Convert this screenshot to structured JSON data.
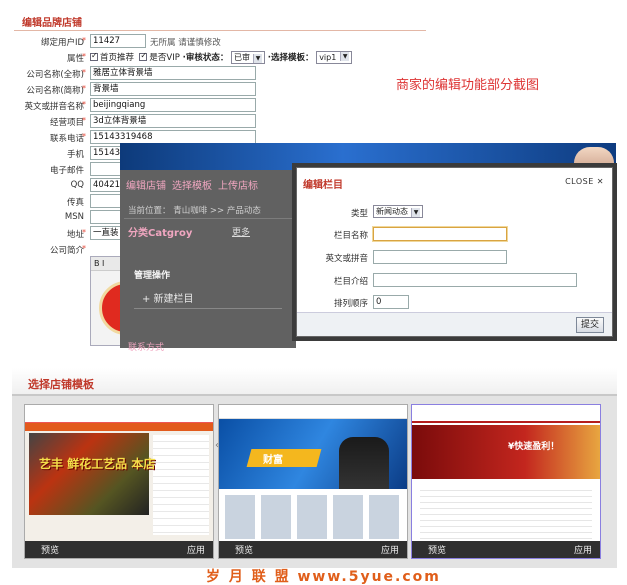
{
  "form": {
    "title": "编辑品牌店铺",
    "fields": [
      {
        "label": "绑定用户ID",
        "value": "11427",
        "note": "无所属  请谨慎修改"
      },
      {
        "label": "属性",
        "check1": "首页推荐",
        "check2": "是否VIP",
        "audit_label": "审核状态：",
        "audit_value": "已审",
        "tpl_label": "选择模板：",
        "tpl_value": "vip1"
      },
      {
        "label": "公司名称(全称)",
        "value": "雅居立体背景墙"
      },
      {
        "label": "公司名称(简称)",
        "value": "背景墙"
      },
      {
        "label": "英文或拼音名称",
        "value": "beijingqiang"
      },
      {
        "label": "经营项目",
        "value": "3d立体背景墙"
      },
      {
        "label": "联系电话",
        "value": "15143319468"
      },
      {
        "label": "手机",
        "value": "1514331"
      },
      {
        "label": "电子邮件",
        "value": ""
      },
      {
        "label": "QQ",
        "value": "40421345"
      },
      {
        "label": "传真",
        "value": ""
      },
      {
        "label": "MSN",
        "value": ""
      },
      {
        "label": "地址",
        "value": "一直装"
      },
      {
        "label": "公司简介",
        "value": ""
      }
    ],
    "editor_tools": "B I"
  },
  "annotation": "商家的编辑功能部分截图",
  "store_panel": {
    "nav": [
      "编辑店铺",
      "选择模板",
      "上传店标"
    ],
    "crumb": "当前位置：  青山咖啡  >> 产品动态",
    "category_title": "分类Catgroy",
    "more": "更多",
    "manage": "管理操作",
    "new_column": "+ 新建栏目",
    "bottom": "联系方式"
  },
  "modal": {
    "title": "编辑栏目",
    "close": "CLOSE ✕",
    "type_label": "类型",
    "type_value": "新闻动态",
    "name_label": "栏目名称",
    "name_value": "",
    "en_label": "英文或拼音",
    "en_value": "",
    "intro_label": "栏目介绍",
    "intro_value": "",
    "order_label": "排列顺序",
    "order_value": "0",
    "submit": "提交"
  },
  "templates": {
    "title": "选择店铺模板",
    "items": [
      {
        "preview": "预览",
        "apply": "应用",
        "shop_text": "艺丰 鲜花工艺品 本店"
      },
      {
        "preview": "预览",
        "apply": "应用",
        "banner_text": "财富"
      },
      {
        "preview": "预览",
        "apply": "应用",
        "banner_text": "¥快速盈利！"
      }
    ]
  },
  "watermark": "岁 月 联 盟  www.5yue.com"
}
